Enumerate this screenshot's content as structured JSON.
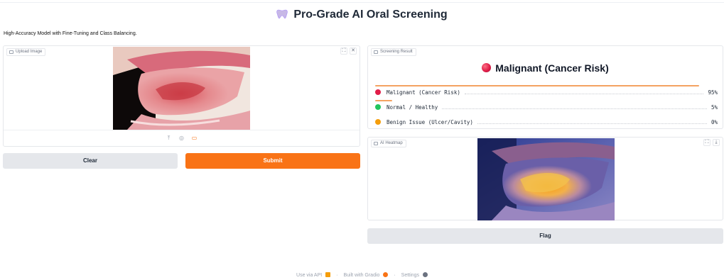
{
  "header": {
    "title": "Pro-Grade AI Oral Screening",
    "description": "High-Accuracy Model with Fine-Tuning and Class Balancing.",
    "title_icon": "tooth-icon"
  },
  "upload": {
    "label": "Upload Image",
    "tools": [
      "upload-icon",
      "webcam-icon",
      "clipboard-icon"
    ],
    "corner_buttons": [
      "fullscreen-icon",
      "close-icon"
    ]
  },
  "buttons": {
    "clear": "Clear",
    "submit": "Submit",
    "flag": "Flag"
  },
  "result": {
    "label": "Screening Result",
    "top_label": "Malignant (Cancer Risk)",
    "confidences": [
      {
        "label": "Malignant (Cancer Risk)",
        "value": "95%",
        "fraction": 0.95,
        "color": "#e11d48"
      },
      {
        "label": "Normal / Healthy",
        "value": "5%",
        "fraction": 0.05,
        "color": "#22c55e"
      },
      {
        "label": "Benign Issue (Ulcer/Cavity)",
        "value": "0%",
        "fraction": 0.0,
        "color": "#f59e0b"
      }
    ]
  },
  "heatmap": {
    "label": "AI Heatmap",
    "corner_buttons": [
      "fullscreen-icon",
      "download-icon"
    ]
  },
  "footer": {
    "api": "Use via API",
    "built": "Built with Gradio",
    "settings": "Settings",
    "sep": "·"
  },
  "colors": {
    "accent": "#f97316",
    "button_gray": "#e5e7eb",
    "bar": "#f4a261"
  }
}
